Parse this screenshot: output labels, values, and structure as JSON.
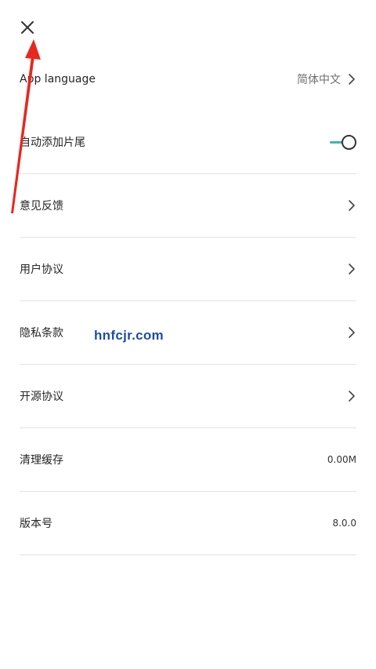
{
  "header": {
    "close_icon": "close-icon"
  },
  "settings": {
    "app_language": {
      "label": "App language",
      "value": "简体中文"
    },
    "auto_outro": {
      "label": "自动添加片尾",
      "enabled": true
    },
    "feedback": {
      "label": "意见反馈"
    },
    "user_agreement": {
      "label": "用户协议"
    },
    "privacy": {
      "label": "隐私条款"
    },
    "open_source": {
      "label": "开源协议"
    },
    "clear_cache": {
      "label": "清理缓存",
      "value": "0.00M"
    },
    "version": {
      "label": "版本号",
      "value": "8.0.0"
    }
  },
  "watermark": {
    "text": "hnfcjr.com"
  },
  "colors": {
    "accent": "#3fb7a4",
    "arrow": "#e8281e",
    "watermark": "#1d4ea8"
  }
}
